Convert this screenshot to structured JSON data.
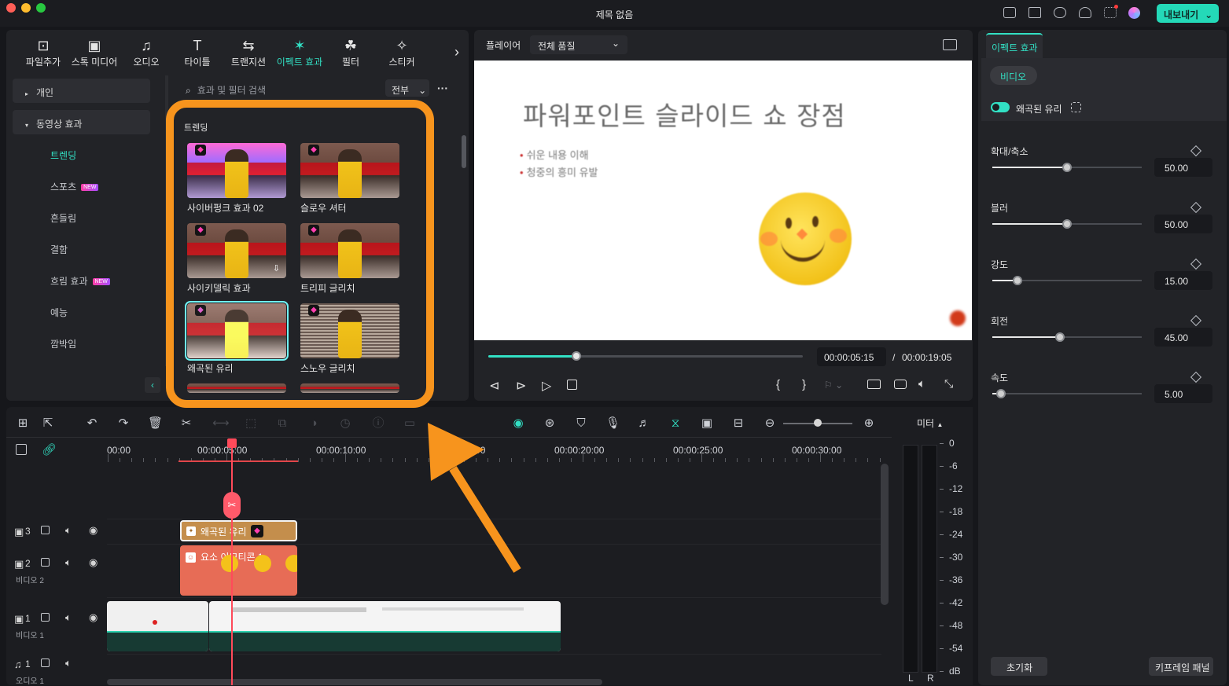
{
  "window": {
    "title": "제목 없음",
    "export_label": "내보내기"
  },
  "toolbar": {
    "items": [
      {
        "label": "파일추가",
        "icon": "file-import-icon"
      },
      {
        "label": "스톡 미디어",
        "icon": "stock-media-icon"
      },
      {
        "label": "오디오",
        "icon": "audio-note-icon"
      },
      {
        "label": "타이틀",
        "icon": "title-T-icon"
      },
      {
        "label": "트랜지션",
        "icon": "transition-icon"
      },
      {
        "label": "이펙트 효과",
        "icon": "effects-sparkle-icon",
        "active": true
      },
      {
        "label": "필터",
        "icon": "filter-icon"
      },
      {
        "label": "스티커",
        "icon": "sticker-icon"
      }
    ],
    "more": "›"
  },
  "sidebar": {
    "sections": [
      {
        "label": "개인"
      },
      {
        "label": "동영상 효과"
      }
    ],
    "items": [
      {
        "label": "트렌딩",
        "active": true,
        "new": false
      },
      {
        "label": "스포츠",
        "new": true
      },
      {
        "label": "흔들림",
        "new": false
      },
      {
        "label": "결함",
        "new": false
      },
      {
        "label": "흐림 효과",
        "new": true
      },
      {
        "label": "예능",
        "new": false
      },
      {
        "label": "깜박임",
        "new": false
      }
    ],
    "new_badge": "NEW"
  },
  "search": {
    "placeholder": "효과 및 필터 검색",
    "filter_value": "전부",
    "more": "···"
  },
  "effects": {
    "section_title": "트렌딩",
    "items": [
      {
        "label": "사이버펑크 효과 02"
      },
      {
        "label": "슬로우 셔터"
      },
      {
        "label": "사이키델릭 효과"
      },
      {
        "label": "트리피 글리치"
      },
      {
        "label": "왜곡된 유리",
        "selected": true
      },
      {
        "label": "스노우 글리치"
      }
    ]
  },
  "player": {
    "label": "플레이어",
    "quality": "전체 품질",
    "slide_title": "파워포인트 슬라이드 쇼 장점",
    "bullets": [
      "쉬운 내용 이해",
      "청중의 흥미 유발"
    ],
    "current_time": "00:00:05:15",
    "separator": "/",
    "total_time": "00:00:19:05",
    "progress": 0.28
  },
  "props": {
    "tab": "이펙트 효과",
    "subtab": "비디오",
    "effect_name": "왜곡된 유리",
    "params": [
      {
        "label": "확대/축소",
        "value": "50.00",
        "level": 0.5
      },
      {
        "label": "블러",
        "value": "50.00",
        "level": 0.5
      },
      {
        "label": "강도",
        "value": "15.00",
        "level": 0.17
      },
      {
        "label": "회전",
        "value": "45.00",
        "level": 0.45
      },
      {
        "label": "속도",
        "value": "5.00",
        "level": 0.06
      }
    ],
    "reset": "초기화",
    "keyframe": "키프레임 패널"
  },
  "timeline": {
    "ruler": [
      "00:00",
      "00:00:05:00",
      "00:00:10:00",
      "00:00:15:00",
      "00:00:20:00",
      "00:00:25:00",
      "00:00:30:00"
    ],
    "tracks": [
      {
        "num": "3",
        "name": ""
      },
      {
        "num": "2",
        "name": "비디오 2"
      },
      {
        "num": "1",
        "name": "비디오 1"
      },
      {
        "num": "1",
        "name": "오디오 1"
      }
    ],
    "clips": {
      "effect": "왜곡된 유리",
      "sticker": "요소 이모티콘 1"
    }
  },
  "meter": {
    "label": "미터",
    "db": [
      "0",
      "-6",
      "-12",
      "-18",
      "-24",
      "-30",
      "-36",
      "-42",
      "-48",
      "-54",
      "dB"
    ],
    "left": "L",
    "right": "R"
  }
}
